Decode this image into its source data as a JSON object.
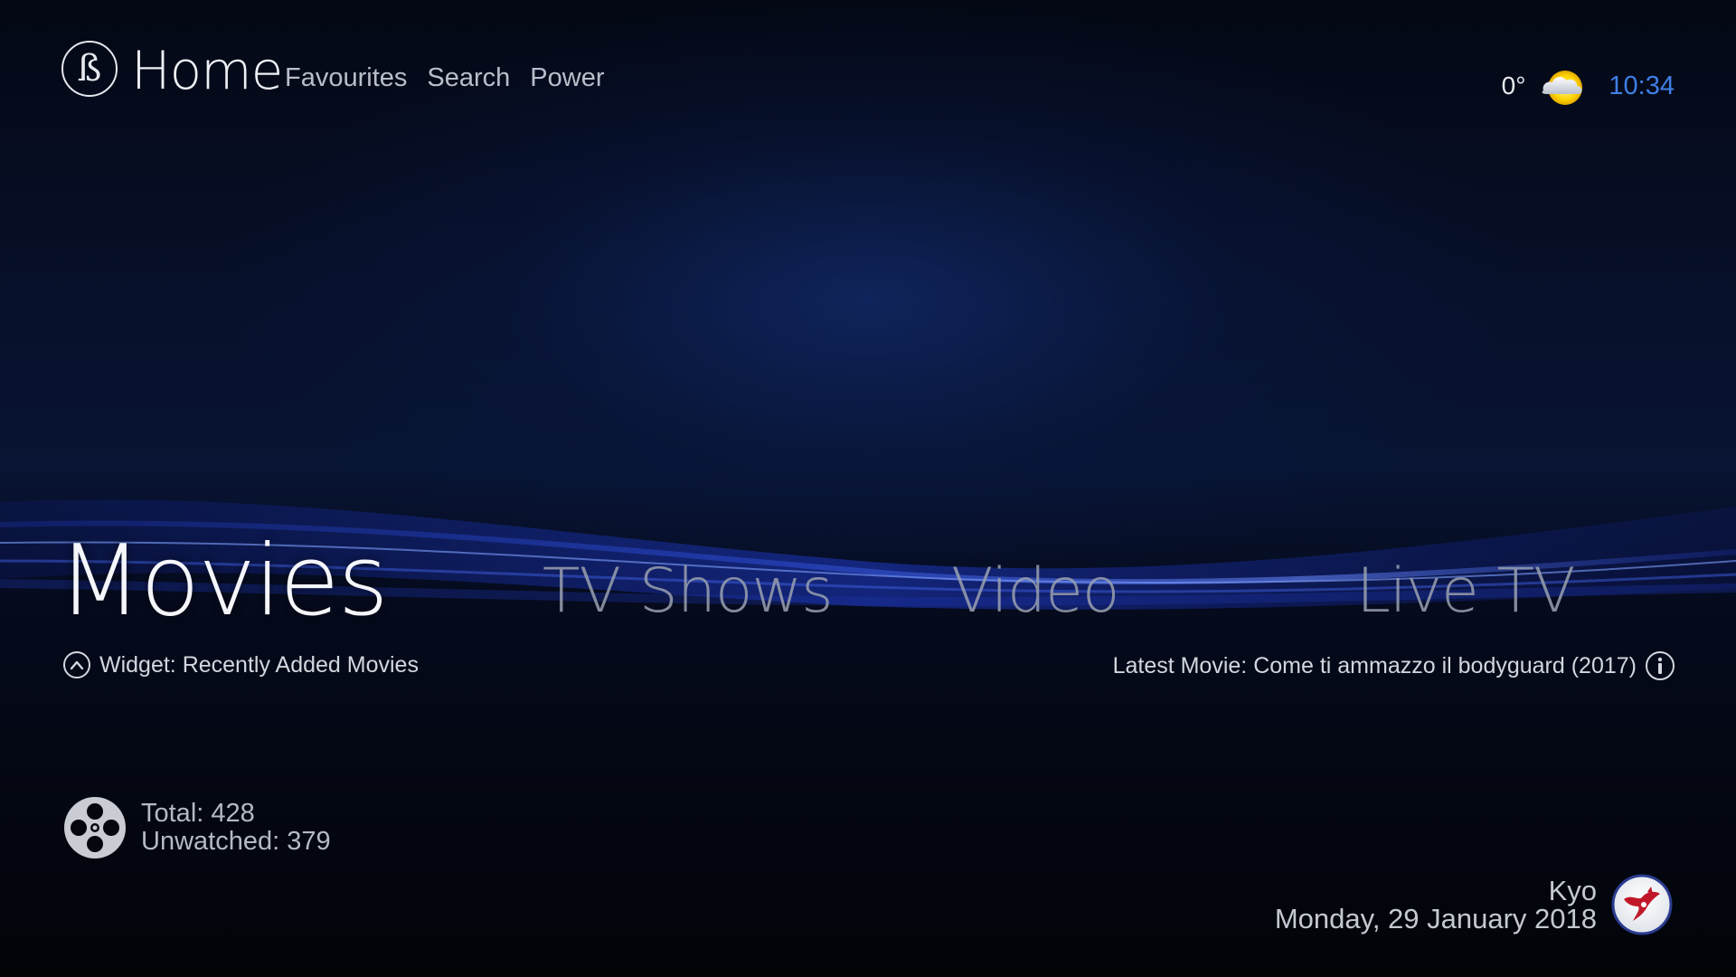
{
  "header": {
    "logo_glyph": "ß",
    "title": "Home",
    "nav": [
      "Favourites",
      "Search",
      "Power"
    ]
  },
  "status": {
    "temperature": "0°",
    "weather_icon": "partly-cloudy-icon",
    "time": "10:34",
    "time_color": "#3f7fe6"
  },
  "main_menu": {
    "items": [
      {
        "label": "Movies",
        "active": true
      },
      {
        "label": "TV Shows",
        "active": false
      },
      {
        "label": "Video",
        "active": false
      },
      {
        "label": "Live TV",
        "active": false
      }
    ]
  },
  "widget_hint": {
    "icon": "chevron-up-circle-icon",
    "text": "Widget: Recently Added Movies"
  },
  "latest": {
    "text": "Latest Movie: Come ti ammazzo il bodyguard (2017)",
    "icon": "info-icon"
  },
  "stats": {
    "icon": "film-reel-icon",
    "total": "Total: 428",
    "unwatched": "Unwatched: 379"
  },
  "profile": {
    "username": "Kyo",
    "date": "Monday, 29 January 2018",
    "avatar_icon": "user-avatar-icon"
  }
}
